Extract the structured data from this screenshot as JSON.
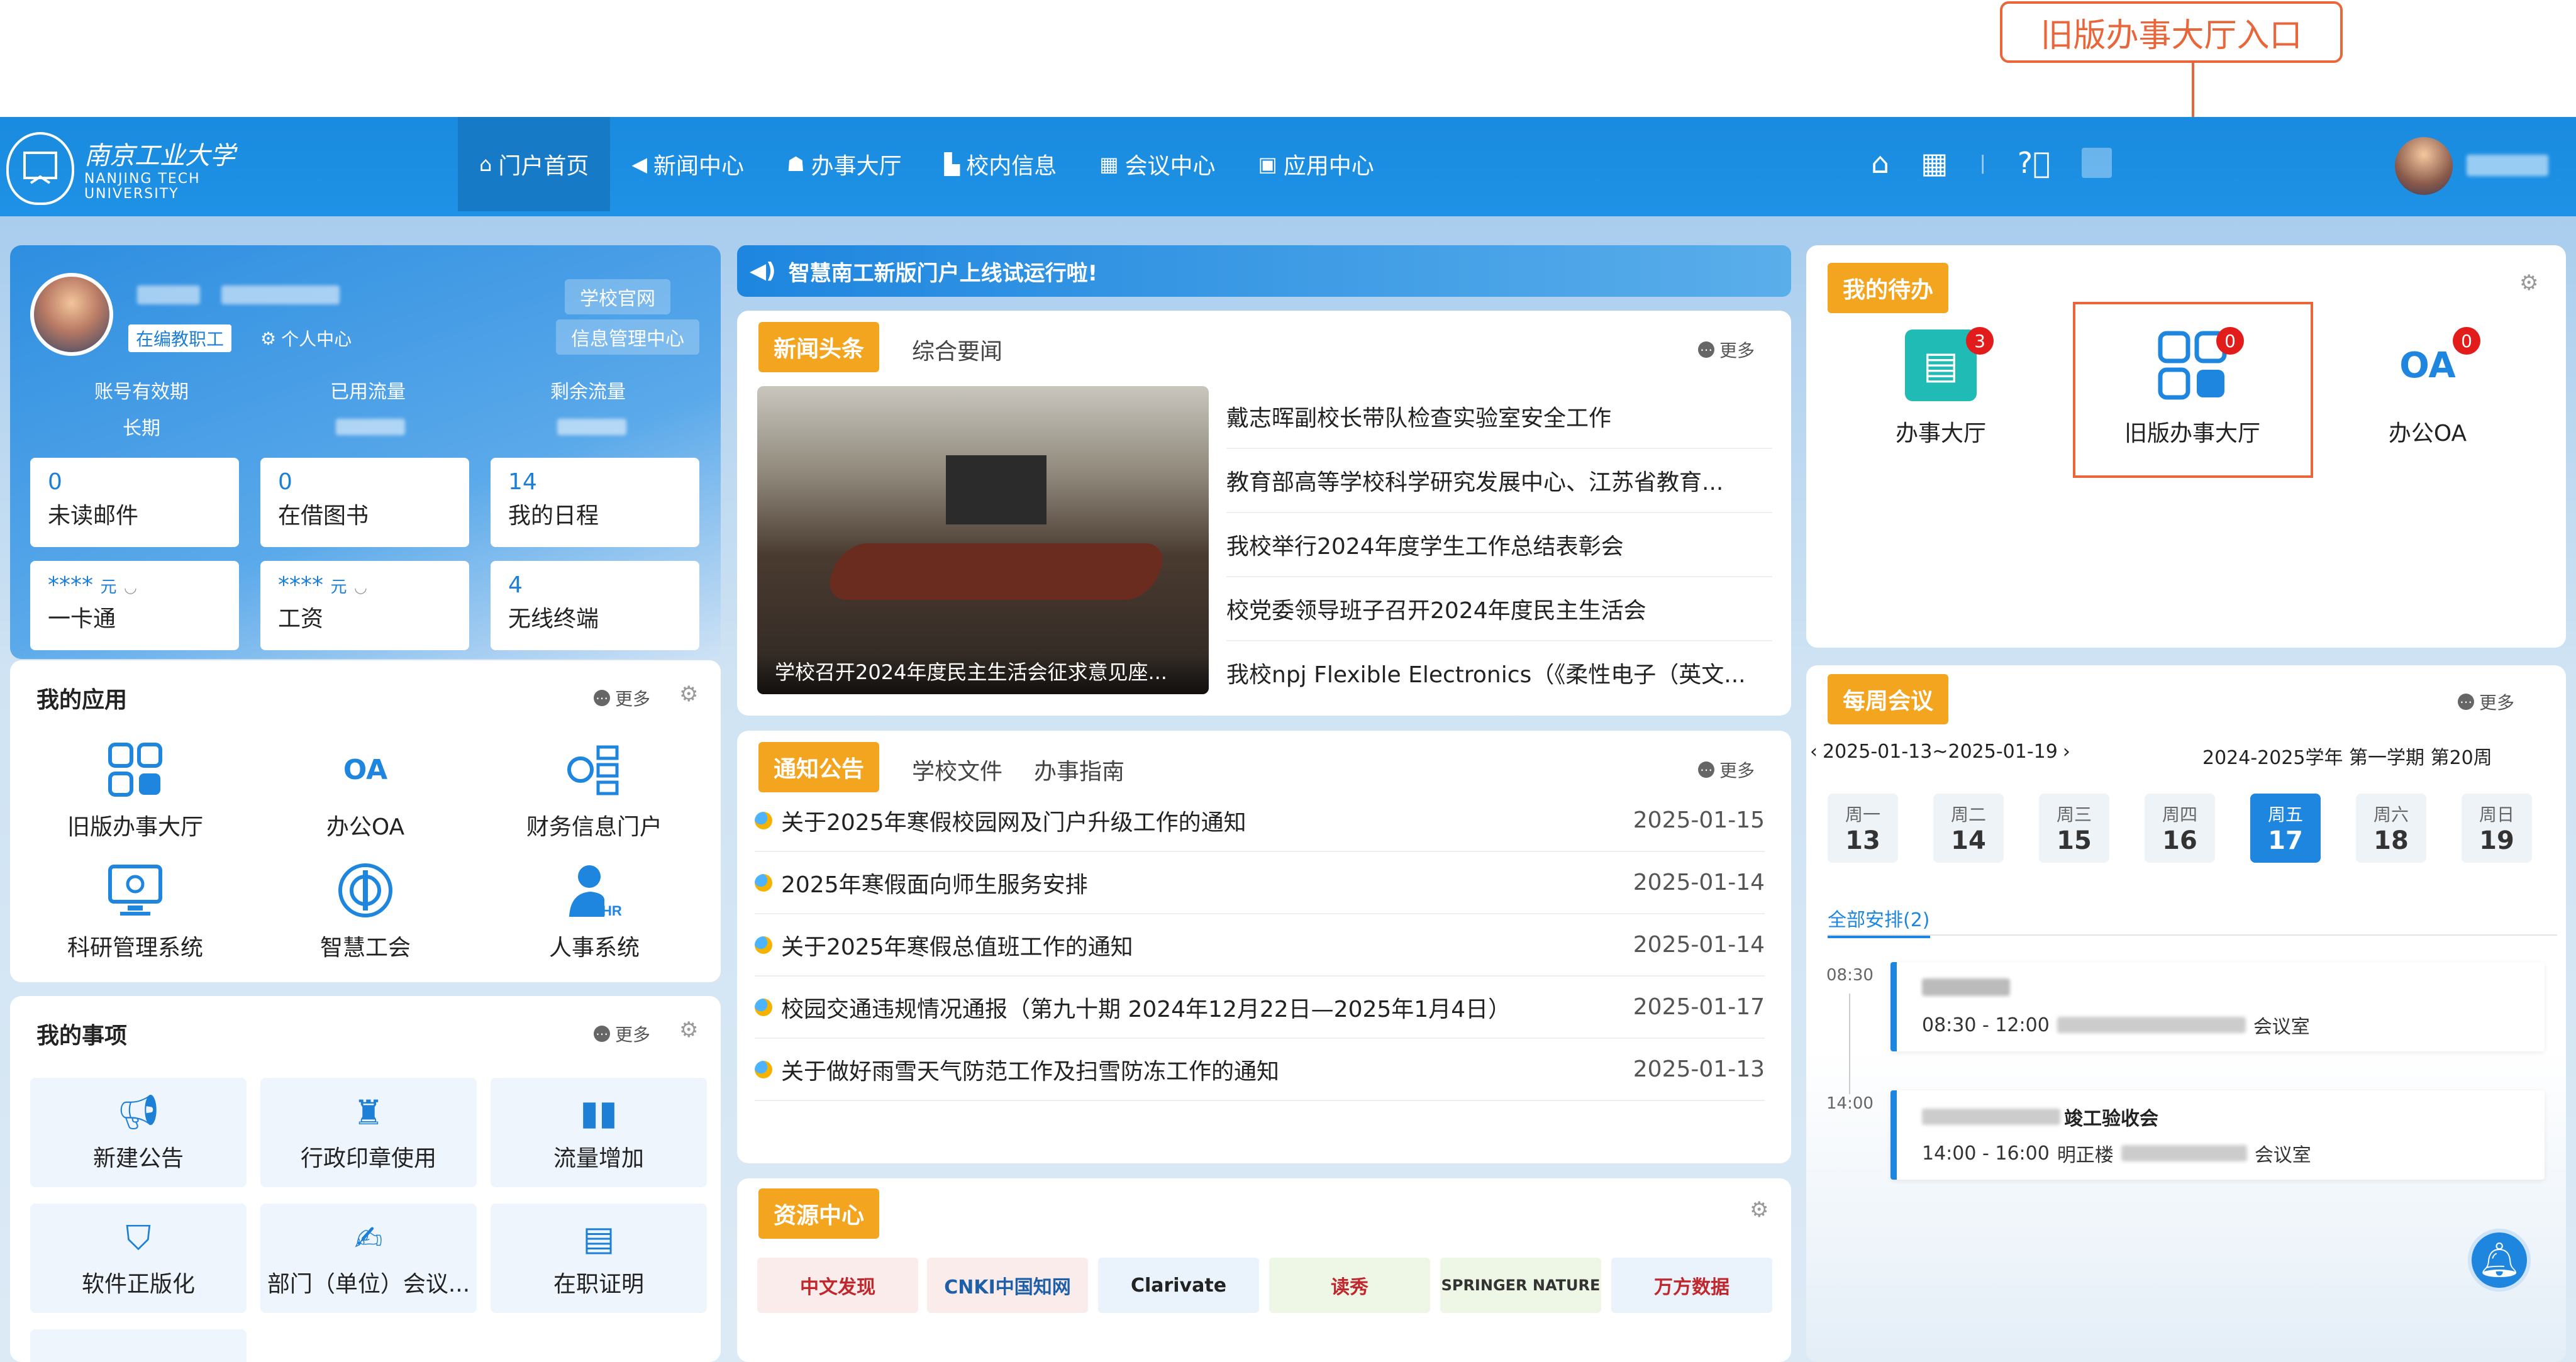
{
  "callout": {
    "label": "旧版办事大厅入口"
  },
  "header": {
    "logo": {
      "cn": "南京工业大学",
      "en1": "NANJING TECH",
      "en2": "UNIVERSITY"
    },
    "nav": [
      {
        "label": "门户首页",
        "icon": "home-icon",
        "glyph": "⌂"
      },
      {
        "label": "新闻中心",
        "icon": "speaker-icon",
        "glyph": "◀)"
      },
      {
        "label": "办事大厅",
        "icon": "bag-icon",
        "glyph": "☗"
      },
      {
        "label": "校内信息",
        "icon": "building-icon",
        "glyph": "▙"
      },
      {
        "label": "会议中心",
        "icon": "table-icon",
        "glyph": "▦"
      },
      {
        "label": "应用中心",
        "icon": "grid-icon",
        "glyph": "▣"
      }
    ]
  },
  "profile": {
    "role_tag": "在编教职工",
    "personal_center": "个人中心",
    "links": [
      "学校官网",
      "信息管理中心"
    ],
    "stats_labels": [
      "账号有效期",
      "已用流量",
      "剩余流量"
    ],
    "validity": "长期",
    "tiles": [
      {
        "num": "0",
        "label": "未读邮件"
      },
      {
        "num": "0",
        "label": "在借图书"
      },
      {
        "num": "14",
        "label": "我的日程"
      },
      {
        "num": "****",
        "unit": "元",
        "label": "一卡通"
      },
      {
        "num": "****",
        "unit": "元",
        "label": "工资"
      },
      {
        "num": "4",
        "label": "无线终端"
      }
    ]
  },
  "my_apps": {
    "title": "我的应用",
    "more": "更多",
    "apps": [
      "旧版办事大厅",
      "办公OA",
      "财务信息门户",
      "科研管理系统",
      "智慧工会",
      "人事系统"
    ]
  },
  "my_matters": {
    "title": "我的事项",
    "more": "更多",
    "items": [
      "新建公告",
      "行政印章使用",
      "流量增加",
      "软件正版化",
      "部门（单位）会议...",
      "在职证明"
    ]
  },
  "banner": {
    "text": "智慧南工新版门户上线试运行啦!"
  },
  "news": {
    "tabs": [
      "新闻头条",
      "综合要闻"
    ],
    "more": "更多",
    "image_caption": "学校召开2024年度民主生活会征求意见座...",
    "items": [
      "戴志晖副校长带队检查实验室安全工作",
      "教育部高等学校科学研究发展中心、江苏省教育...",
      "我校举行2024年度学生工作总结表彰会",
      "校党委领导班子召开2024年度民主生活会",
      "我校npj Flexible Electronics（《柔性电子（英文..."
    ]
  },
  "notices": {
    "tabs": [
      "通知公告",
      "学校文件",
      "办事指南"
    ],
    "more": "更多",
    "items": [
      {
        "title": "关于2025年寒假校园网及门户升级工作的通知",
        "date": "2025-01-15"
      },
      {
        "title": "2025年寒假面向师生服务安排",
        "date": "2025-01-14"
      },
      {
        "title": "关于2025年寒假总值班工作的通知",
        "date": "2025-01-14"
      },
      {
        "title": "校园交通违规情况通报（第九十期 2024年12月22日—2025年1月4日）",
        "date": "2025-01-17"
      },
      {
        "title": "关于做好雨雪天气防范工作及扫雪防冻工作的通知",
        "date": "2025-01-13"
      }
    ]
  },
  "resources": {
    "title": "资源中心",
    "logos": [
      "中文发现",
      "CNKI中国知网",
      "Clarivate",
      "读秀",
      "SPRINGER NATURE",
      "万方数据"
    ]
  },
  "todo": {
    "title": "我的待办",
    "items": [
      {
        "label": "办事大厅",
        "count": "3"
      },
      {
        "label": "旧版办事大厅",
        "count": "0"
      },
      {
        "label": "办公OA",
        "count": "0"
      }
    ]
  },
  "meetings": {
    "title": "每周会议",
    "more": "更多",
    "range": "2025-01-13~2025-01-19",
    "term": "2024-2025学年 第一学期 第20周",
    "days": [
      {
        "w": "周一",
        "d": "13"
      },
      {
        "w": "周二",
        "d": "14"
      },
      {
        "w": "周三",
        "d": "15"
      },
      {
        "w": "周四",
        "d": "16"
      },
      {
        "w": "周五",
        "d": "17"
      },
      {
        "w": "周六",
        "d": "18"
      },
      {
        "w": "周日",
        "d": "19"
      }
    ],
    "active_day": "17",
    "all_label": "全部安排(2)",
    "entries": [
      {
        "time": "08:30",
        "title": "",
        "detail_time": "08:30 - 12:00",
        "room": "会议室"
      },
      {
        "time": "14:00",
        "title": "竣工验收会",
        "detail_time": "14:00 - 16:00",
        "place": "明正楼",
        "room": "会议室"
      }
    ]
  }
}
